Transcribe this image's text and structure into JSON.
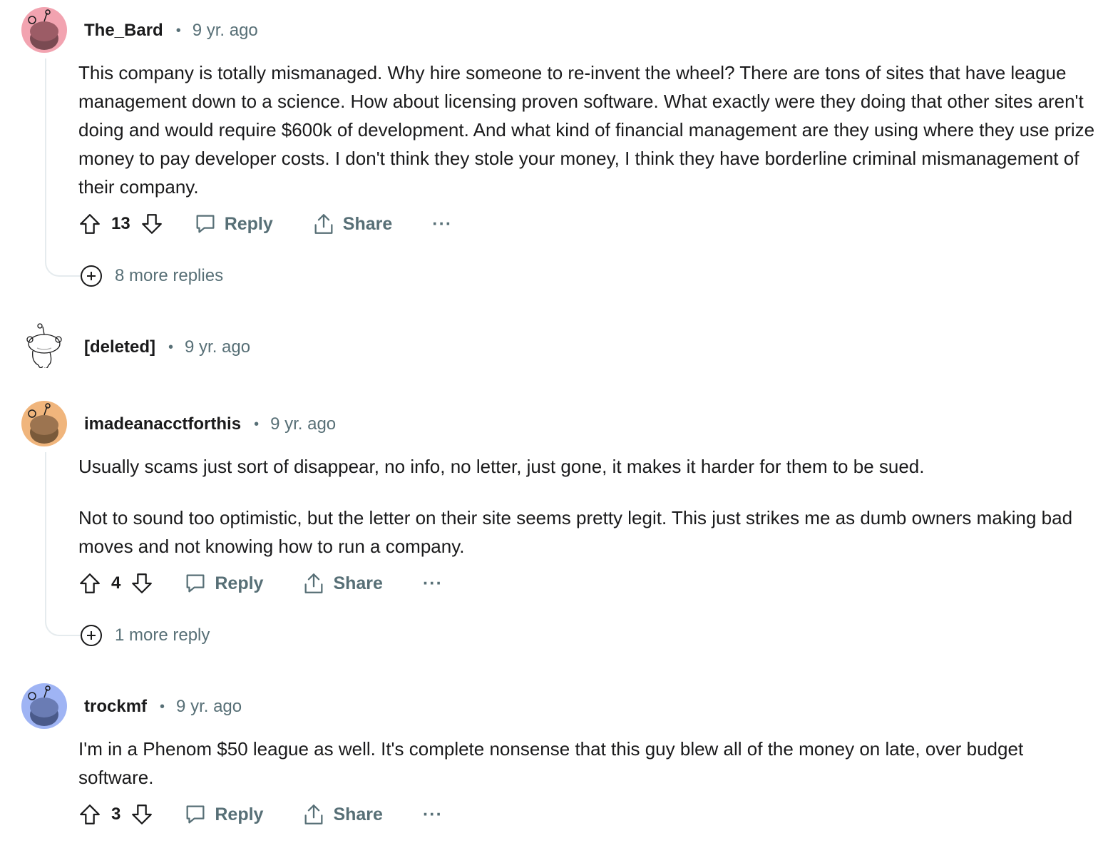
{
  "comments": [
    {
      "author": "The_Bard",
      "time": "9 yr. ago",
      "avatar_color": "#f2a3b0",
      "paragraphs": [
        "This company is totally mismanaged. Why hire someone to re-invent the wheel? There are tons of sites that have league management down to a science. How about licensing proven software. What exactly were they doing that other sites aren't doing and would require $600k of development. And what kind of financial management are they using where they use prize money to pay developer costs. I don't think they stole your money, I think they have borderline criminal mismanagement of their company."
      ],
      "score": "13",
      "more_replies": "8 more replies"
    },
    {
      "author": "[deleted]",
      "time": "9 yr. ago"
    },
    {
      "author": "imadeanacctforthis",
      "time": "9 yr. ago",
      "avatar_color": "#f0b57c",
      "paragraphs": [
        "Usually scams just sort of disappear, no info, no letter, just gone, it makes it harder for them to be sued.",
        "Not to sound too optimistic, but the letter on their site seems pretty legit. This just strikes me as dumb owners making bad moves and not knowing how to run a company."
      ],
      "score": "4",
      "more_replies": "1 more reply"
    },
    {
      "author": "trockmf",
      "time": "9 yr. ago",
      "avatar_color": "#9fb4f4",
      "paragraphs": [
        "I'm in a Phenom $50 league as well. It's complete nonsense that this guy blew all of the money on late, over budget software."
      ],
      "score": "3"
    }
  ],
  "labels": {
    "reply": "Reply",
    "share": "Share",
    "more": "···",
    "meta_sep": "•"
  },
  "icons": [
    "upvote-icon",
    "downvote-icon",
    "reply-icon",
    "share-icon",
    "more-options-icon",
    "expand-plus-icon",
    "snoo-avatar-icon"
  ],
  "colors": {
    "text": "#1a1a1b",
    "muted": "#576f76",
    "thread": "#e5ebee"
  }
}
